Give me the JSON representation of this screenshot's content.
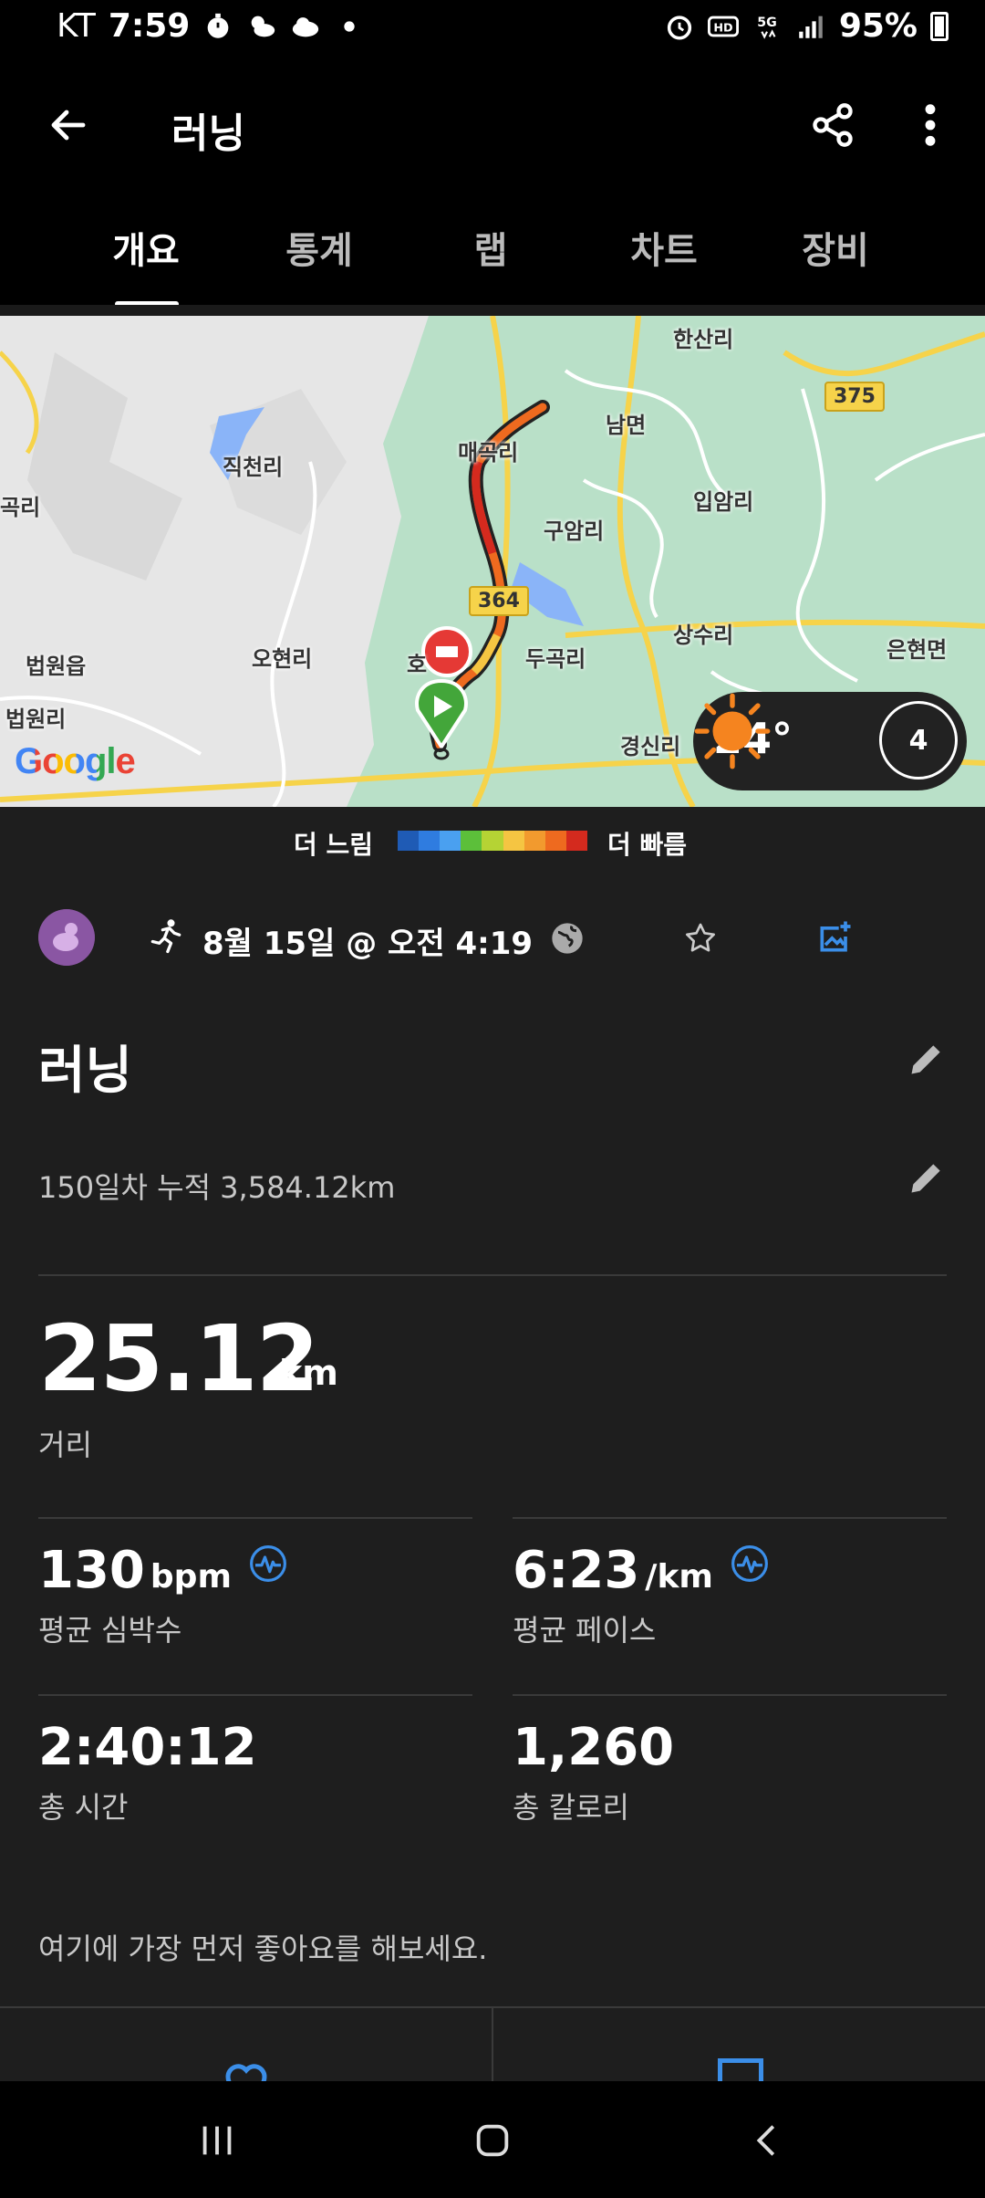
{
  "status_bar": {
    "carrier": "KT",
    "time": "7:59",
    "battery": "95%",
    "hd_label": "HD",
    "network_label": "5G"
  },
  "app_bar": {
    "title": "러닝",
    "back_icon": "arrow-left-icon",
    "share_icon": "share-icon",
    "more_icon": "more-vertical-icon"
  },
  "tabs": [
    {
      "label": "개요",
      "active": true
    },
    {
      "label": "통계",
      "active": false
    },
    {
      "label": "랩",
      "active": false
    },
    {
      "label": "차트",
      "active": false
    },
    {
      "label": "장비",
      "active": false
    }
  ],
  "map": {
    "labels": {
      "hansan": "한산리",
      "jikcheon": "직천리",
      "maegok": "매곡리",
      "nammyeon": "남면",
      "ibam": "입암리",
      "gugokri": "곡리",
      "guam": "구암리",
      "ohyeon": "오현리",
      "beobwoneup": "법원읍",
      "dugok": "두곡리",
      "sangsu": "상수리",
      "eunhyeon": "은현면",
      "beobwon": "법원리",
      "gyeongsin": "경신리",
      "ho": "호"
    },
    "road_364": "364",
    "road_375": "375",
    "google": "Google",
    "weather": {
      "temperature": "24°",
      "condition_icon": "sun-icon",
      "wind": "4"
    }
  },
  "legend": {
    "slow": "더 느림",
    "fast": "더 빠름",
    "colors": [
      "#1f5bb5",
      "#2f7ce0",
      "#4aa0f0",
      "#5cbf3a",
      "#b5d334",
      "#f5c542",
      "#f29a2e",
      "#ee6a1f",
      "#d42a1e"
    ]
  },
  "meta": {
    "date": "8월 15일 @ 오전 4:19",
    "activity_icon": "running-icon",
    "privacy_icon": "globe-icon",
    "favorite_icon": "star-icon",
    "photo_icon": "add-photo-icon"
  },
  "activity": {
    "title": "러닝",
    "description": "150일차 누적 3,584.12km"
  },
  "stats": {
    "distance": {
      "value": "25.12",
      "unit": "km",
      "label": "거리"
    },
    "heart_rate": {
      "value": "130",
      "unit": "bpm",
      "label": "평균 심박수"
    },
    "pace": {
      "value": "6:23",
      "unit": "/km",
      "label": "평균 페이스"
    },
    "time": {
      "value": "2:40:12",
      "label": "총 시간"
    },
    "calories": {
      "value": "1,260",
      "label": "총 칼로리"
    }
  },
  "social": {
    "like_prompt": "여기에 가장 먼저 좋아요를 해보세요.",
    "like_icon": "heart-icon",
    "comment_icon": "comment-icon"
  },
  "nav": {
    "recents_icon": "recents-icon",
    "home_icon": "home-icon",
    "back_icon": "nav-back-icon"
  },
  "colors": {
    "accent_blue": "#3b8ee8",
    "background": "#1e1e1e",
    "map_green": "#b9e0c8"
  }
}
